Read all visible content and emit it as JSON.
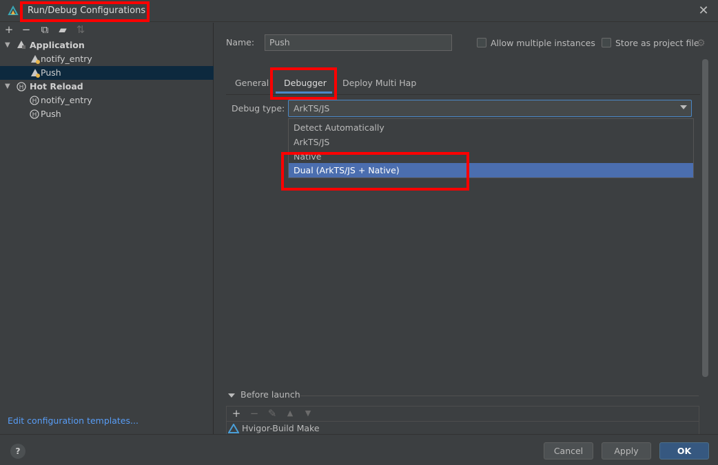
{
  "window": {
    "title": "Run/Debug Configurations"
  },
  "tree": {
    "items": [
      {
        "label": "Application",
        "bold": true
      },
      {
        "label": "notify_entry"
      },
      {
        "label": "Push",
        "selected": true
      },
      {
        "label": "Hot Reload",
        "bold": true
      },
      {
        "label": "notify_entry"
      },
      {
        "label": "Push"
      }
    ],
    "edit_templates": "Edit configuration templates..."
  },
  "form": {
    "name_label": "Name:",
    "name_value": "Push",
    "allow_multiple": "Allow multiple instances",
    "store_project": "Store as project file"
  },
  "tabs": [
    "General",
    "Debugger",
    "Deploy Multi Hap"
  ],
  "debugger": {
    "debug_type_label": "Debug type:",
    "debug_type_value": "ArkTS/JS",
    "options": [
      "Detect Automatically",
      "ArkTS/JS",
      "Native",
      "Dual (ArkTS/JS + Native)"
    ],
    "selected_option": "Dual (ArkTS/JS + Native)"
  },
  "before_launch": {
    "label": "Before launch",
    "items": [
      "Hvigor-Build Make"
    ]
  },
  "buttons": {
    "help": "?",
    "cancel": "Cancel",
    "apply": "Apply",
    "ok": "OK"
  },
  "colors": {
    "accent": "#4a88c7",
    "selection": "#4b6eaf",
    "highlight": "#ff0000",
    "tree_selected": "#0d293e"
  }
}
